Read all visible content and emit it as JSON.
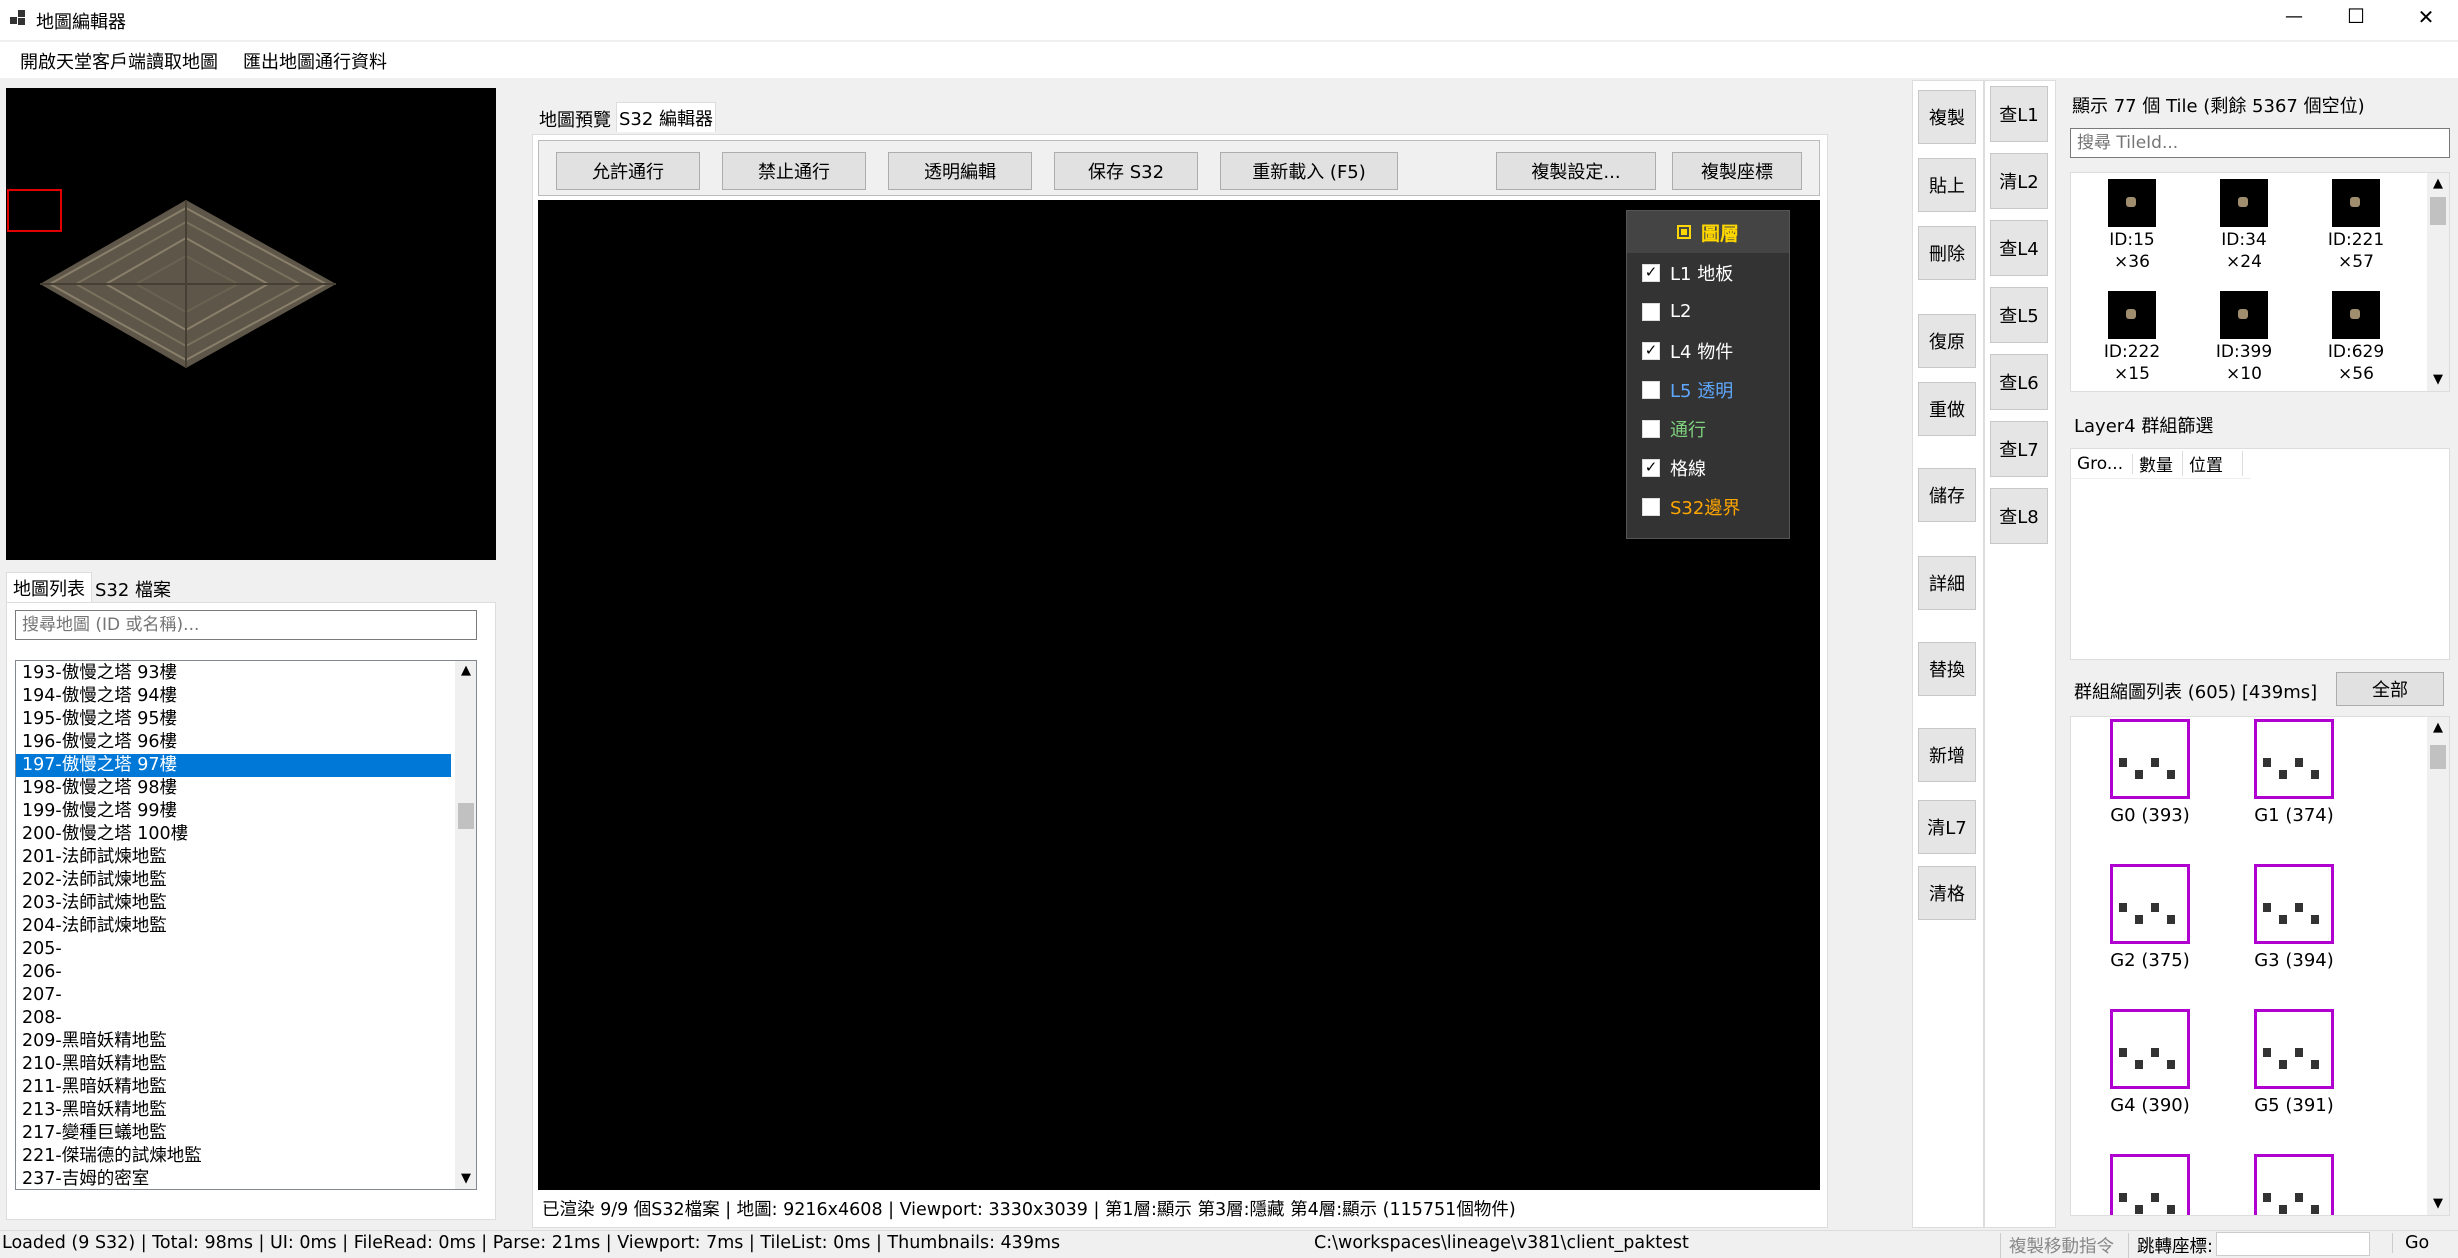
{
  "window": {
    "title": "地圖編輯器",
    "minimize": "—",
    "maximize": "☐",
    "close": "✕"
  },
  "menu": [
    {
      "label": "開啟天堂客戶端讀取地圖"
    },
    {
      "label": "匯出地圖通行資料"
    }
  ],
  "left": {
    "tabs": [
      {
        "label": "地圖列表"
      },
      {
        "label": "S32 檔案"
      }
    ],
    "search_placeholder": "搜尋地圖 (ID 或名稱)...",
    "maps": [
      "193-傲慢之塔 93樓",
      "194-傲慢之塔 94樓",
      "195-傲慢之塔 95樓",
      "196-傲慢之塔 96樓",
      "197-傲慢之塔 97樓",
      "198-傲慢之塔 98樓",
      "199-傲慢之塔 99樓",
      "200-傲慢之塔 100樓",
      "201-法師試煉地監",
      "202-法師試煉地監",
      "203-法師試煉地監",
      "204-法師試煉地監",
      "205-",
      "206-",
      "207-",
      "208-",
      "209-黑暗妖精地監",
      "210-黑暗妖精地監",
      "211-黑暗妖精地監",
      "213-黑暗妖精地監",
      "217-變種巨蟻地監",
      "221-傑瑞德的試煉地監",
      "237-吉姆的密室"
    ],
    "selected_index": 4
  },
  "editor": {
    "tabs": [
      {
        "label": "地圖預覽"
      },
      {
        "label": "S32 編輯器"
      }
    ],
    "toolbar": {
      "allow": "允許通行",
      "forbid": "禁止通行",
      "transparent": "透明編輯",
      "save": "保存 S32",
      "reload": "重新載入 (F5)",
      "copy_settings": "複製設定...",
      "copy_coords": "複製座標"
    },
    "layers": {
      "title": "圖層",
      "items": [
        {
          "label": "L1 地板",
          "checked": true,
          "color": "#ffffff"
        },
        {
          "label": "L2",
          "checked": false,
          "color": "#ffffff"
        },
        {
          "label": "L4 物件",
          "checked": true,
          "color": "#ffffff"
        },
        {
          "label": "L5 透明",
          "checked": false,
          "color": "#5fa8ff"
        },
        {
          "label": "通行",
          "checked": false,
          "color": "#7fd17f"
        },
        {
          "label": "格線",
          "checked": true,
          "color": "#ffffff"
        },
        {
          "label": "S32邊界",
          "checked": false,
          "color": "#ffa500"
        }
      ]
    },
    "status": "已渲染 9/9 個S32檔案 | 地圖: 9216x4608 | Viewport: 3330x3039 | 第1層:顯示 第3層:隱藏 第4層:顯示 (115751個物件)"
  },
  "actions": [
    {
      "label": "複製"
    },
    {
      "label": "貼上"
    },
    {
      "label": "刪除"
    },
    {
      "label": "復原"
    },
    {
      "label": "重做"
    },
    {
      "label": "儲存"
    },
    {
      "label": "詳細"
    },
    {
      "label": "替換"
    },
    {
      "label": "新增"
    },
    {
      "label": "清L7"
    },
    {
      "label": "清格"
    }
  ],
  "layer_actions": [
    {
      "label": "查L1"
    },
    {
      "label": "清L2"
    },
    {
      "label": "查L4"
    },
    {
      "label": "查L5"
    },
    {
      "label": "查L6"
    },
    {
      "label": "查L7"
    },
    {
      "label": "查L8"
    }
  ],
  "right": {
    "tile_header": "顯示 77 個 Tile (剩餘 5367 個空位)",
    "tile_search_placeholder": "搜尋 TileId...",
    "tiles": [
      {
        "id": "ID:15",
        "count": "×36"
      },
      {
        "id": "ID:34",
        "count": "×24"
      },
      {
        "id": "ID:221",
        "count": "×57"
      },
      {
        "id": "ID:222",
        "count": "×15"
      },
      {
        "id": "ID:399",
        "count": "×10"
      },
      {
        "id": "ID:629",
        "count": "×56"
      }
    ],
    "group_filter_label": "Layer4 群組篩選",
    "group_columns": [
      "Gro...",
      "數量",
      "位置"
    ],
    "group_list_label": "群組縮圖列表 (605) [439ms]",
    "all_button": "全部",
    "groups": [
      {
        "label": "G0 (393)"
      },
      {
        "label": "G1 (374)"
      },
      {
        "label": "G2 (375)"
      },
      {
        "label": "G3 (394)"
      },
      {
        "label": "G4 (390)"
      },
      {
        "label": "G5 (391)"
      },
      {
        "label": ""
      },
      {
        "label": ""
      }
    ]
  },
  "statusbar": {
    "left": "Loaded (9 S32) | Total: 98ms | UI: 0ms | FileRead: 0ms | Parse: 21ms | Viewport: 7ms | TileList: 0ms | Thumbnails: 439ms",
    "path": "C:\\workspaces\\lineage\\v381\\client_paktest",
    "copy_move": "複製移動指令",
    "jump_label": "跳轉座標:",
    "jump_value": "",
    "go": "Go"
  }
}
